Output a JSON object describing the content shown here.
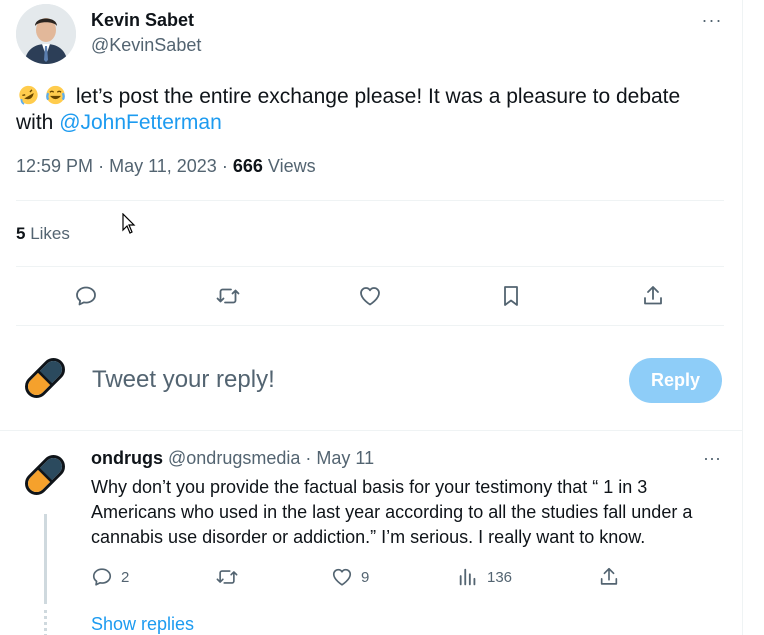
{
  "tweet": {
    "author_name": "Kevin Sabet",
    "author_handle": "@KevinSabet",
    "more_label": "···",
    "text_before_mention": "let’s post the entire exchange please! It was a pleasure to debate with ",
    "mention": "@JohnFetterman",
    "emojis": [
      "rolling-on-floor-laughing-emoji",
      "face-with-tears-of-joy-emoji"
    ],
    "time": "12:59 PM",
    "separator": "·",
    "date": "May 11, 2023",
    "views_count": "666",
    "views_label": "Views",
    "likes_count": "5",
    "likes_label": "Likes",
    "actions": [
      "reply-icon",
      "retweet-icon",
      "like-icon",
      "bookmark-icon",
      "share-icon"
    ]
  },
  "composer": {
    "placeholder": "Tweet your reply!",
    "reply_button": "Reply",
    "avatar": "pill-avatar"
  },
  "reply": {
    "name": "ondrugs",
    "handle": "@ondrugsmedia",
    "separator": "·",
    "date": "May 11",
    "more_label": "···",
    "text": "Why don’t you provide the factual basis for your testimony that “ 1 in 3 Americans who used in the last year according to all the studies fall under a cannabis use disorder or addiction.” I’m serious. I really want to know.",
    "reply_count": "2",
    "retweet_count": "",
    "like_count": "9",
    "views_count": "136",
    "show_replies": "Show replies"
  },
  "colors": {
    "accent": "#1d9bf0",
    "reply_button_disabled": "#8ecdf8",
    "secondary_text": "#536471",
    "pill_dark": "#2b4a5e",
    "pill_orange": "#f5a12c"
  }
}
